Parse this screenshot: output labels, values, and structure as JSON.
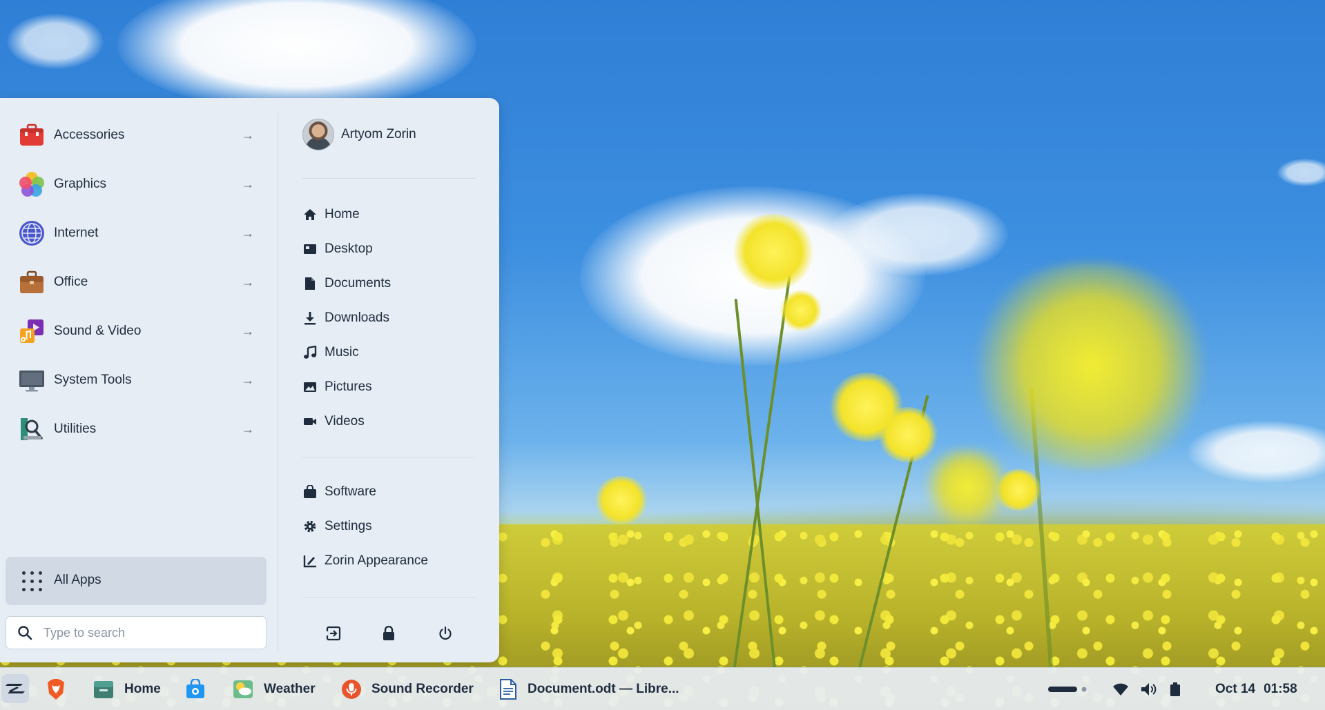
{
  "menu": {
    "categories": [
      {
        "label": "Accessories",
        "icon": "toolbox-icon"
      },
      {
        "label": "Graphics",
        "icon": "graphics-icon"
      },
      {
        "label": "Internet",
        "icon": "globe-icon"
      },
      {
        "label": "Office",
        "icon": "briefcase-icon"
      },
      {
        "label": "Sound & Video",
        "icon": "media-icon"
      },
      {
        "label": "System Tools",
        "icon": "monitor-icon"
      },
      {
        "label": "Utilities",
        "icon": "utilities-icon"
      }
    ],
    "all_apps_label": "All Apps",
    "search": {
      "placeholder": "Type to search",
      "value": ""
    },
    "user_name": "Artyom Zorin",
    "places": [
      {
        "label": "Home",
        "icon": "home-icon"
      },
      {
        "label": "Desktop",
        "icon": "desktop-icon"
      },
      {
        "label": "Documents",
        "icon": "document-icon"
      },
      {
        "label": "Downloads",
        "icon": "download-icon"
      },
      {
        "label": "Music",
        "icon": "music-icon"
      },
      {
        "label": "Pictures",
        "icon": "picture-icon"
      },
      {
        "label": "Videos",
        "icon": "video-icon"
      }
    ],
    "system": [
      {
        "label": "Software",
        "icon": "software-icon"
      },
      {
        "label": "Settings",
        "icon": "gear-icon"
      },
      {
        "label": "Zorin Appearance",
        "icon": "appearance-icon"
      }
    ],
    "session": [
      "logout-icon",
      "lock-icon",
      "power-icon"
    ]
  },
  "taskbar": {
    "apps": [
      {
        "label": "",
        "icon": "brave-browser-icon"
      },
      {
        "label": "Home",
        "icon": "files-icon"
      },
      {
        "label": "",
        "icon": "software-store-icon"
      },
      {
        "label": "Weather",
        "icon": "weather-icon"
      },
      {
        "label": "Sound Recorder",
        "icon": "microphone-icon"
      },
      {
        "label": "Document.odt — Libre...",
        "icon": "writer-document-icon"
      }
    ],
    "date": "Oct 14",
    "time": "01:58"
  },
  "colors": {
    "menu_bg": "#e6edf5",
    "taskbar_bg": "#e8eef5",
    "text": "#1f2c3d",
    "accent": "#2a3646"
  }
}
